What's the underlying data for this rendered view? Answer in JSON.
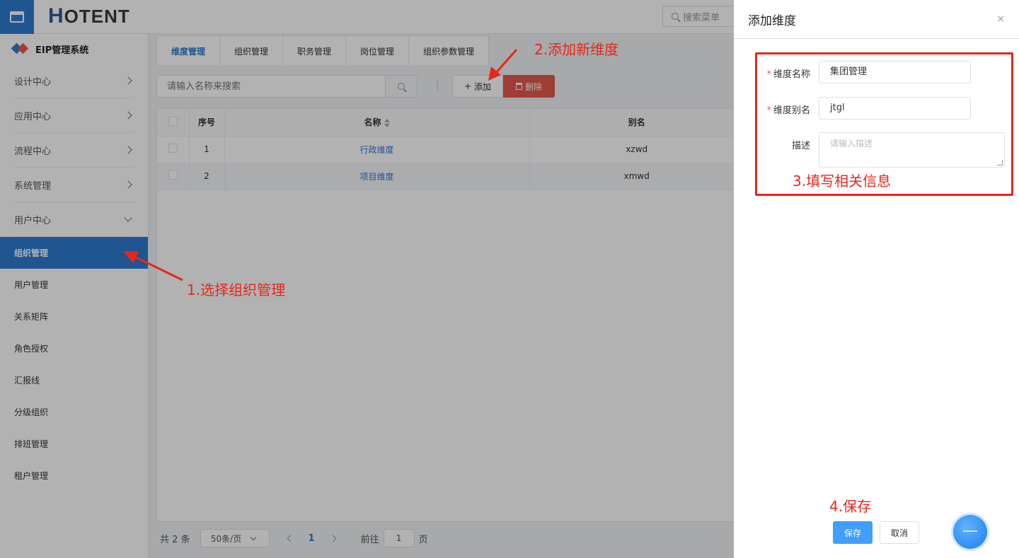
{
  "topbar": {
    "logo_h": "H",
    "logo_rest": "OTENT",
    "search_placeholder": "搜索菜单"
  },
  "sidebar": {
    "brand": "EIP管理系统",
    "groups": [
      {
        "label": "设计中心"
      },
      {
        "label": "应用中心"
      },
      {
        "label": "流程中心"
      },
      {
        "label": "系统管理"
      },
      {
        "label": "用户中心"
      }
    ],
    "sub_items": [
      {
        "label": "组织管理"
      },
      {
        "label": "用户管理"
      },
      {
        "label": "关系矩阵"
      },
      {
        "label": "角色授权"
      },
      {
        "label": "汇报线"
      },
      {
        "label": "分级组织"
      },
      {
        "label": "排班管理"
      },
      {
        "label": "租户管理"
      }
    ]
  },
  "main": {
    "tabs": [
      {
        "label": "维度管理"
      },
      {
        "label": "组织管理"
      },
      {
        "label": "职务管理"
      },
      {
        "label": "岗位管理"
      },
      {
        "label": "组织参数管理"
      }
    ],
    "search_placeholder": "请输入名称来搜索",
    "add_label": "添加",
    "delete_label": "删除",
    "table": {
      "headers": [
        "序号",
        "名称",
        "别名"
      ],
      "rows": [
        {
          "index": "1",
          "name": "行政维度",
          "alias": "xzwd"
        },
        {
          "index": "2",
          "name": "项目维度",
          "alias": "xmwd"
        }
      ]
    },
    "pager": {
      "total": "共 2 条",
      "page_size": "50条/页",
      "current": "1",
      "goto_prefix": "前往",
      "goto_value": "1",
      "goto_suffix": "页"
    }
  },
  "drawer": {
    "title": "添加维度",
    "close": "×",
    "fields": [
      {
        "label": "维度名称",
        "required": "*",
        "value": "集团管理"
      },
      {
        "label": "维度别名",
        "required": "*",
        "value": "jtgl"
      },
      {
        "label": "描述",
        "placeholder": "请输入描述"
      }
    ],
    "save_label": "保存",
    "cancel_label": "取消"
  },
  "annotations": {
    "step1": "1.选择组织管理",
    "step2": "2.添加新维度",
    "step3": "3.填写相关信息",
    "step4": "4.保存",
    "color": "#e8261b"
  },
  "colors": {
    "primary": "#2d7bd0",
    "danger": "#e2584e",
    "save": "#409eff"
  }
}
